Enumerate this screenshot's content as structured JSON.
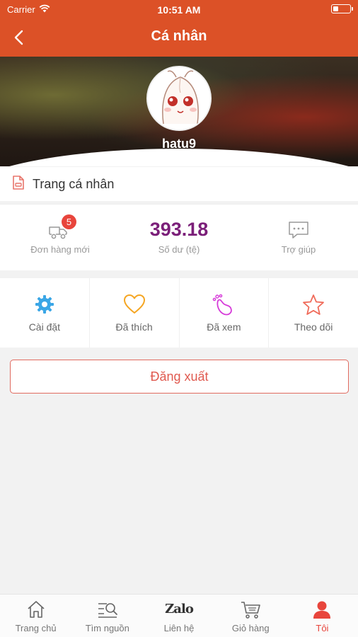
{
  "status_bar": {
    "carrier": "Carrier",
    "time": "10:51 AM"
  },
  "header": {
    "title": "Cá nhân"
  },
  "profile": {
    "username": "hatu9"
  },
  "personal_page": {
    "label": "Trang cá nhân"
  },
  "stats": {
    "orders": {
      "label": "Đơn hàng mới",
      "badge": "5"
    },
    "balance": {
      "value": "393.18",
      "label": "Số dư (tệ)"
    },
    "help": {
      "label": "Trợ giúp"
    }
  },
  "menu": {
    "settings": "Cài đặt",
    "liked": "Đã thích",
    "viewed": "Đã xem",
    "following": "Theo dõi"
  },
  "logout_label": "Đăng xuất",
  "tabs": {
    "home": "Trang chủ",
    "search": "Tìm nguồn",
    "contact": "Liên hệ",
    "contact_logo": "Zalo",
    "cart": "Giỏ hàng",
    "me": "Tôi"
  },
  "colors": {
    "header": "#dc5127",
    "accent_red": "#e8453c",
    "balance_purple": "#7b1f79",
    "settings_blue": "#3aa6e6",
    "liked_orange": "#f5a623",
    "viewed_magenta": "#d63bd9",
    "following_red": "#f06b5a"
  }
}
